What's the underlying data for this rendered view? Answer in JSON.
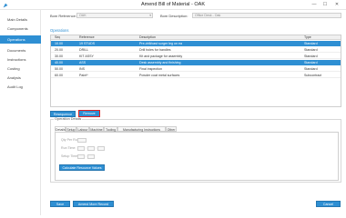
{
  "window": {
    "title": "Amend Bill of Material - OAK",
    "minimize": "—",
    "maximize": "☐",
    "close": "✕"
  },
  "sidebar": {
    "items": [
      {
        "label": "Main Details"
      },
      {
        "label": "Components"
      },
      {
        "label": "Operations"
      },
      {
        "label": "Documents"
      },
      {
        "label": "Instructions"
      },
      {
        "label": "Costing"
      },
      {
        "label": "Analysis"
      },
      {
        "label": "Audit Log"
      }
    ]
  },
  "header": {
    "bom_reference_label": "Bom Reference:",
    "bom_reference_value": "OAK",
    "bom_description_label": "Bom Description:",
    "bom_description_value": "Office Desk - Oak"
  },
  "operations": {
    "section_label": "Operations",
    "columns": [
      "Seq",
      "Reference",
      "Description",
      "Type"
    ],
    "rows": [
      {
        "seq": "10.00",
        "reference": "19 STUDS",
        "description": "Pre-drill/cast surger leg on ea",
        "type": "Standard",
        "selected": true
      },
      {
        "seq": "20.00",
        "reference": "DRILL",
        "description": "Drill holes for handles",
        "type": "Standard",
        "selected": false
      },
      {
        "seq": "30.00",
        "reference": "KIT ASSY",
        "description": "Kit and package for assembly",
        "type": "Standard",
        "selected": false
      },
      {
        "seq": "40.00",
        "reference": "ASS",
        "description": "Desk assembly and finishing",
        "type": "Standard",
        "selected": false
      },
      {
        "seq": "50.00",
        "reference": "INS",
        "description": "Final inspection",
        "type": "Standard",
        "selected": false
      },
      {
        "seq": "60.00",
        "reference": "Paint*",
        "description": "Powder coat metal surfaces",
        "type": "Subcontract",
        "selected": false
      }
    ],
    "btn_resequence": "Resequence",
    "btn_remove": "Remove"
  },
  "operation_details": {
    "title": "Operation Details",
    "tabs": [
      "Details",
      "Setup",
      "Labour",
      "Machine",
      "Tooling",
      "Manufacturing Instructions",
      "Other"
    ],
    "labels": {
      "qty_per_run": "Qty Per Run:",
      "run_time": "Run Time:",
      "setup_time": "Setup Time:"
    },
    "colon": ":",
    "btn_calculate": "Calculate Resource Values"
  },
  "footer": {
    "btn_save": "Save",
    "btn_amend_more": "Amend More Record",
    "btn_cancel": "Cancel"
  },
  "colors": {
    "accent": "#2e8fd3",
    "highlight_border": "#e02020"
  },
  "icons": {
    "app": "app-logo-icon",
    "dropdown": "chevron-down-icon"
  }
}
